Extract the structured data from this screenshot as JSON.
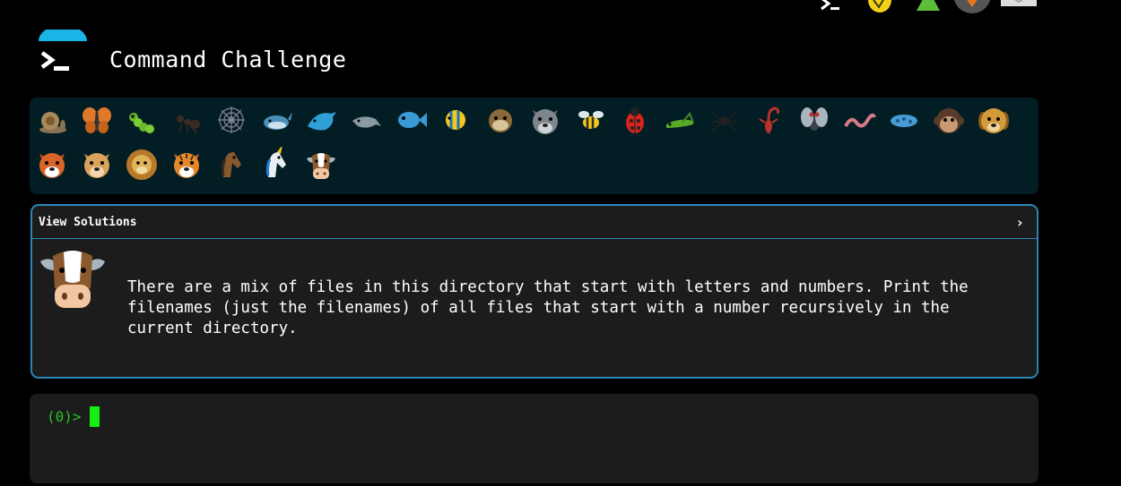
{
  "header": {
    "title": "Command Challenge",
    "logo_icon": "terminal-prompt-icon"
  },
  "top_icons": [
    "terminal-prompt-icon",
    "lightbulb-icon",
    "tree-icon",
    "avatar-icon",
    "mail-icon"
  ],
  "levels": {
    "items": [
      "snail",
      "butterfly",
      "caterpillar",
      "ant",
      "spider-web",
      "whale",
      "dolphin",
      "dolphin-grey",
      "fish",
      "tropical-fish",
      "pufferfish",
      "wolf",
      "bee",
      "ladybug",
      "grasshopper",
      "spider",
      "scorpion",
      "fly",
      "worm",
      "microbe",
      "monkey",
      "dog",
      "fox",
      "cat",
      "lion",
      "tiger",
      "horse",
      "unicorn",
      "cow"
    ],
    "current": "cow"
  },
  "solutions": {
    "label": "View Solutions",
    "chevron": "›"
  },
  "challenge": {
    "avatar": "cow",
    "text": "There are a mix of files in this directory that start with letters and numbers. Print the filenames (just the filenames) of all files that start with a number recursively in the current directory."
  },
  "terminal": {
    "prompt": "(0)>",
    "value": ""
  },
  "colors": {
    "background": "#000000",
    "levels_bg": "#031d24",
    "card_bg": "#1c1c1c",
    "card_border": "#2887b7",
    "prompt": "#27c227",
    "cursor": "#13ee13",
    "logo_dome": "#1ab4e6"
  }
}
